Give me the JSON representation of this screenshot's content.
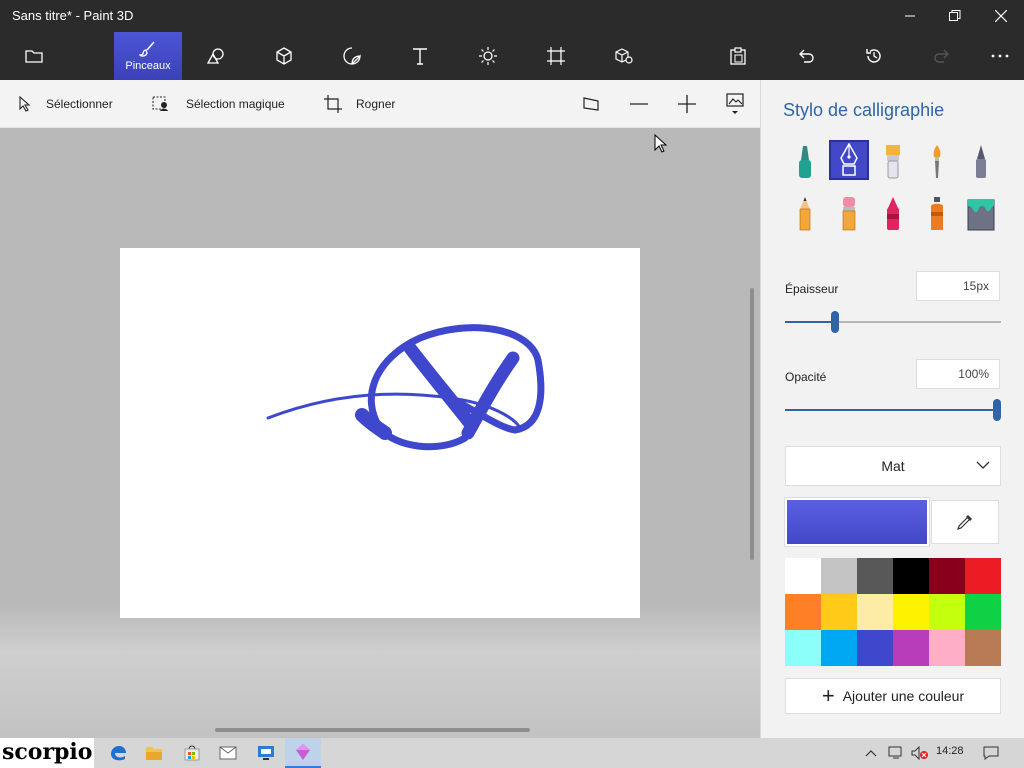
{
  "window": {
    "title": "Sans titre* - Paint 3D"
  },
  "ribbon": {
    "items": [
      {
        "name": "menu",
        "icon": "folder-icon"
      },
      {
        "name": "brushes",
        "label": "Pinceaux",
        "icon": "brush-icon",
        "active": true
      },
      {
        "name": "2d-shapes",
        "icon": "shapes-2d-icon"
      },
      {
        "name": "3d-shapes",
        "icon": "cube-icon"
      },
      {
        "name": "stickers",
        "icon": "sticker-icon"
      },
      {
        "name": "text",
        "icon": "text-icon"
      },
      {
        "name": "effects",
        "icon": "sun-icon"
      },
      {
        "name": "canvas",
        "icon": "crop-canvas-icon"
      },
      {
        "name": "3d-library",
        "icon": "library-3d-icon"
      },
      {
        "name": "paste",
        "icon": "paste-icon"
      },
      {
        "name": "undo",
        "icon": "undo-icon"
      },
      {
        "name": "history",
        "icon": "history-icon"
      },
      {
        "name": "redo",
        "icon": "redo-icon"
      },
      {
        "name": "more",
        "icon": "more-icon"
      }
    ]
  },
  "toolbar": {
    "select": "Sélectionner",
    "magic_select": "Sélection magique",
    "crop": "Rogner"
  },
  "panel": {
    "title": "Stylo de calligraphie",
    "brushes": [
      "marker",
      "calligraphy-pen",
      "oil-brush",
      "watercolor",
      "pixel-pen",
      "pencil",
      "eraser",
      "crayon",
      "spray-can",
      "fill"
    ],
    "selected_brush": "calligraphy-pen",
    "thickness_label": "Épaisseur",
    "thickness_value": "15px",
    "thickness": 15,
    "opacity_label": "Opacité",
    "opacity_value": "100%",
    "opacity": 1.0,
    "finish": "Mat",
    "current_color": "#4248c8",
    "palette": [
      "#ffffff",
      "#c3c3c3",
      "#585858",
      "#000000",
      "#88001b",
      "#ec1c24",
      "#ff7f27",
      "#ffca18",
      "#fdeca6",
      "#fff200",
      "#c4ff0e",
      "#0ed145",
      "#8cfffb",
      "#00a8f3",
      "#3f48cc",
      "#b83dba",
      "#ffaec8",
      "#b97a56"
    ],
    "add_color": "Ajouter une couleur"
  },
  "taskbar": {
    "brand": "scorpio",
    "clock": "14:28",
    "apps": [
      "edge-icon",
      "explorer-icon",
      "store-icon",
      "mail-icon",
      "remote-desktop-icon",
      "paint3d-icon"
    ]
  }
}
